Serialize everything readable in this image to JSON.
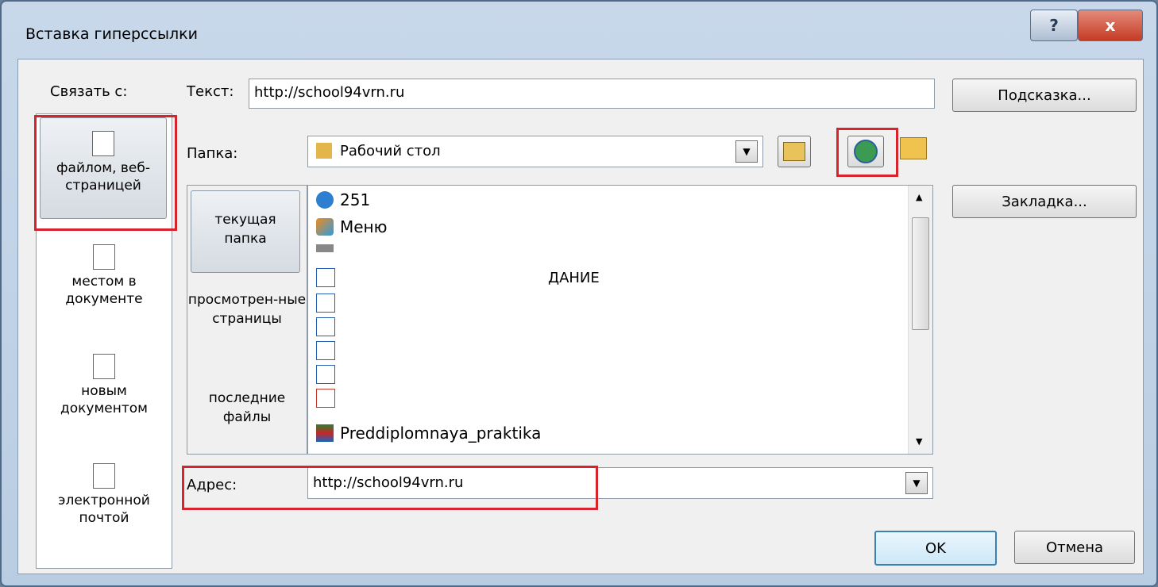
{
  "window": {
    "title": "Вставка гиперссылки",
    "help_label": "?",
    "close_label": "x"
  },
  "link_to": {
    "label": "Связать с:",
    "items": [
      {
        "label": "файлом, веб-страницей"
      },
      {
        "label": "местом в документе"
      },
      {
        "label": "новым документом"
      },
      {
        "label": "электронной почтой"
      }
    ]
  },
  "text_field": {
    "label": "Текст:",
    "value": "http://school94vrn.ru"
  },
  "tooltip_button": {
    "label": "Подсказка..."
  },
  "folder": {
    "label": "Папка:",
    "value": "Рабочий стол"
  },
  "bookmark_button": {
    "label": "Закладка..."
  },
  "look_in": {
    "items": [
      {
        "label": "текущая папка"
      },
      {
        "label": "просмотрен-ные страницы"
      },
      {
        "label": "последние файлы"
      }
    ]
  },
  "files": {
    "items": [
      {
        "name": "251",
        "icon": "network-icon"
      },
      {
        "name": "Меню",
        "icon": "colorful-app-icon"
      },
      {
        "name": "",
        "icon": "drive-icon"
      },
      {
        "name": "ДАНИЕ",
        "icon": "shortcut-icon"
      },
      {
        "name": "",
        "icon": "shortcut-icon"
      },
      {
        "name": "",
        "icon": "shortcut-icon"
      },
      {
        "name": "",
        "icon": "shortcut-icon"
      },
      {
        "name": "",
        "icon": "shortcut-icon"
      },
      {
        "name": "",
        "icon": "shortcut-icon"
      },
      {
        "name": "Preddiplomnaya_praktika",
        "icon": "archive-icon"
      }
    ]
  },
  "address": {
    "label": "Адрес:",
    "value": "http://school94vrn.ru"
  },
  "buttons": {
    "ok": "OK",
    "cancel": "Отмена"
  },
  "colors": {
    "highlight": "#d6232c",
    "titlebar": "#b9cde2"
  }
}
